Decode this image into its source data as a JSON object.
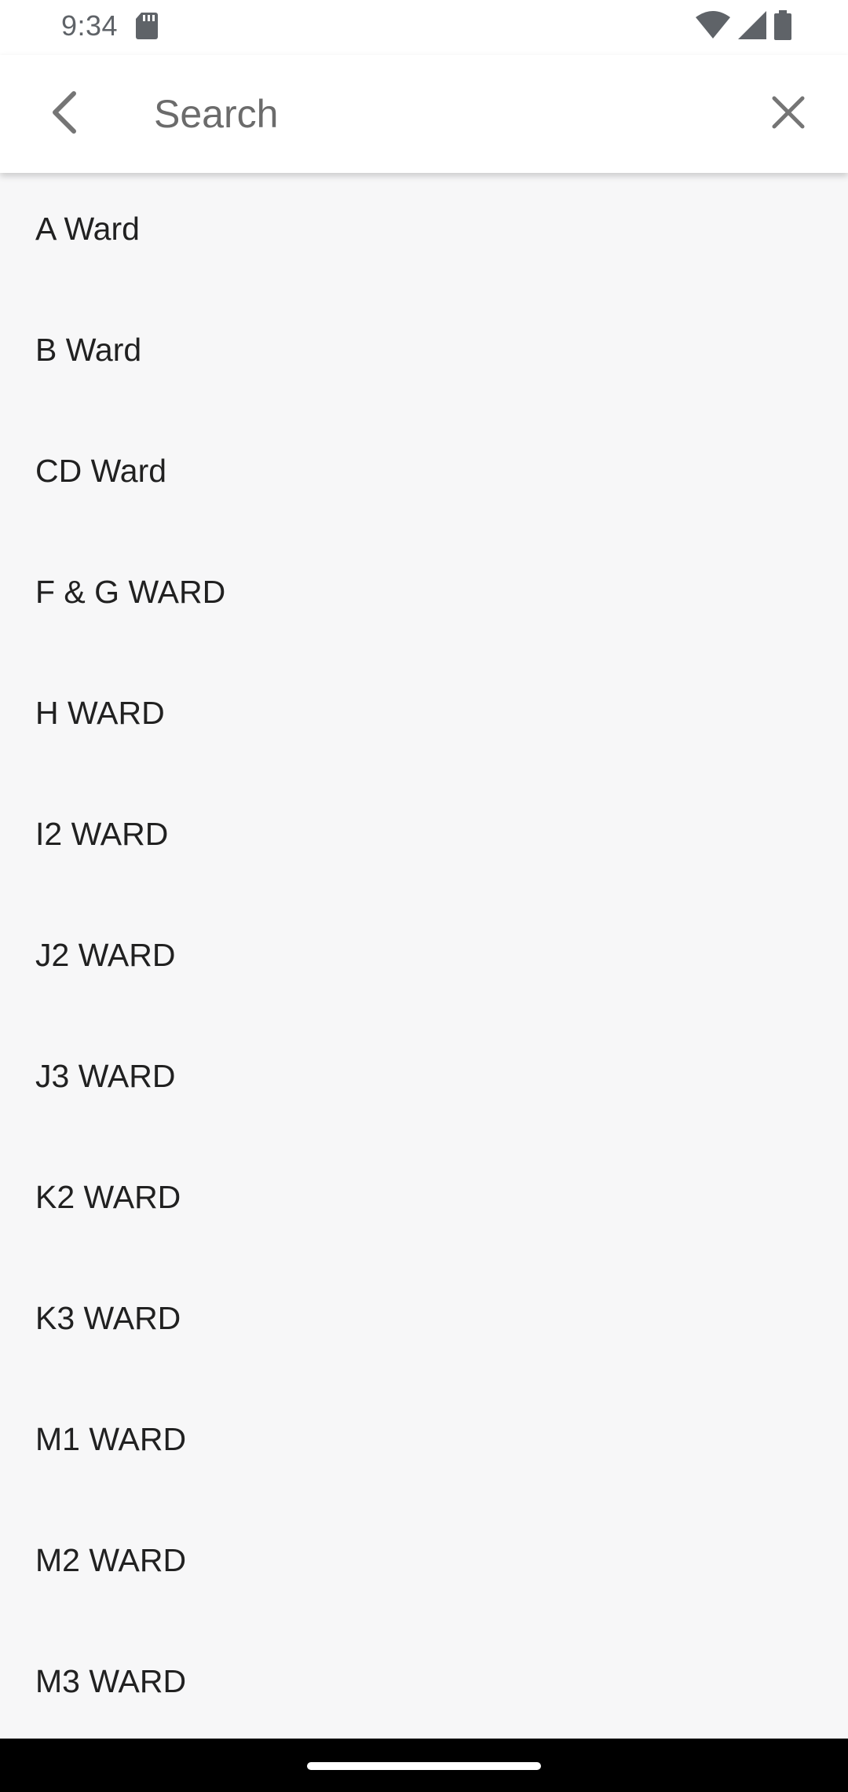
{
  "status_bar": {
    "time": "9:34",
    "icons": [
      "sd-card-icon",
      "wifi-icon",
      "cell-signal-icon",
      "battery-icon"
    ]
  },
  "app_bar": {
    "back_icon": "chevron-left-icon",
    "search": {
      "value": "",
      "placeholder": "Search"
    },
    "clear_icon": "close-icon"
  },
  "wards": [
    {
      "label": "A Ward"
    },
    {
      "label": "B Ward"
    },
    {
      "label": "CD Ward"
    },
    {
      "label": "F & G WARD"
    },
    {
      "label": "H WARD"
    },
    {
      "label": "I2 WARD"
    },
    {
      "label": "J2 WARD"
    },
    {
      "label": "J3 WARD"
    },
    {
      "label": "K2 WARD"
    },
    {
      "label": "K3 WARD"
    },
    {
      "label": "M1 WARD"
    },
    {
      "label": "M2 WARD"
    },
    {
      "label": "M3 WARD"
    }
  ],
  "colors": {
    "app_bar_bg": "#ffffff",
    "list_bg": "#f7f7f8",
    "icon_grey": "#757575",
    "nav_bar_bg": "#000000"
  }
}
